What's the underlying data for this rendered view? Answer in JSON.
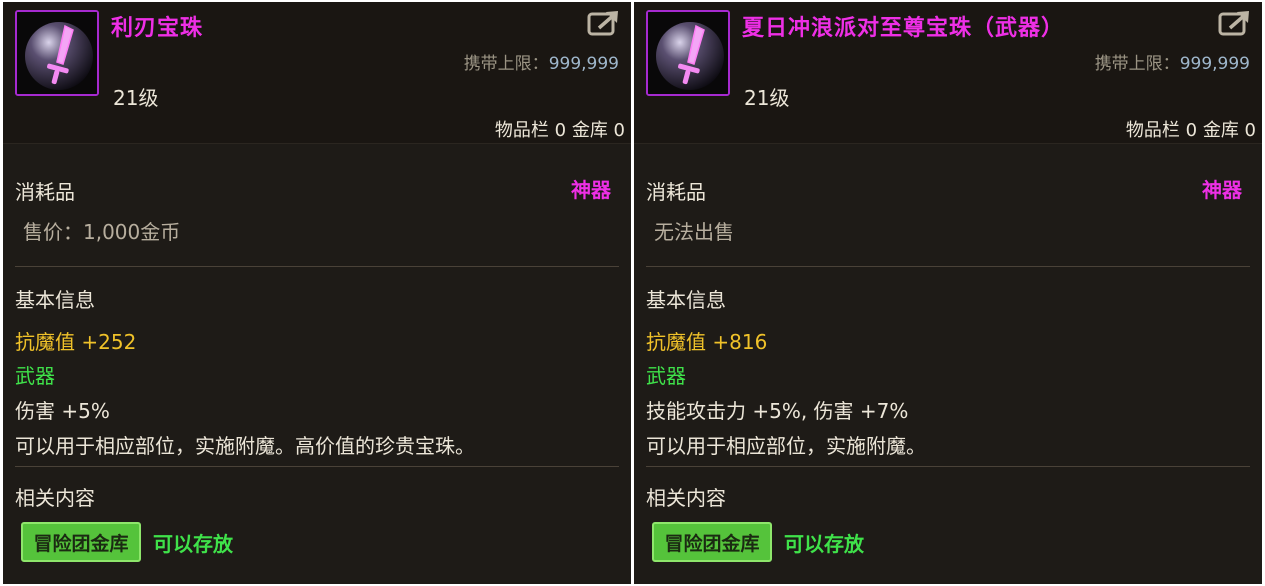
{
  "panels": [
    {
      "title": "利刃宝珠",
      "carry_label": "携带上限：",
      "carry_value": "999,999",
      "level": "21级",
      "storage": "物品栏 0 金库 0",
      "category": "消耗品",
      "rarity": "神器",
      "price": "售价：1,000金币",
      "basic_info_label": "基本信息",
      "stat": "抗魔值 +252",
      "slot": "武器",
      "effect": "伤害 +5%",
      "description": "可以用于相应部位，实施附魔。高价值的珍贵宝珠。",
      "related_label": "相关内容",
      "vault_button": "冒险团金库",
      "vault_status": "可以存放"
    },
    {
      "title": "夏日冲浪派对至尊宝珠（武器）",
      "carry_label": "携带上限：",
      "carry_value": "999,999",
      "level": "21级",
      "storage": "物品栏 0 金库 0",
      "category": "消耗品",
      "rarity": "神器",
      "price": "无法出售",
      "basic_info_label": "基本信息",
      "stat": "抗魔值 +816",
      "slot": "武器",
      "effect": "技能攻击力 +5%, 伤害 +7%",
      "description": "可以用于相应部位，实施附魔。",
      "related_label": "相关内容",
      "vault_button": "冒险团金库",
      "vault_status": "可以存放"
    }
  ],
  "colors": {
    "title": "#ee2fe6",
    "rarity": "#ee2fe6",
    "stat": "#f0c229",
    "slot": "#3fe24a",
    "vault_button": "#55c33b"
  },
  "icons": [
    "orb-sword-icon",
    "share-icon"
  ]
}
